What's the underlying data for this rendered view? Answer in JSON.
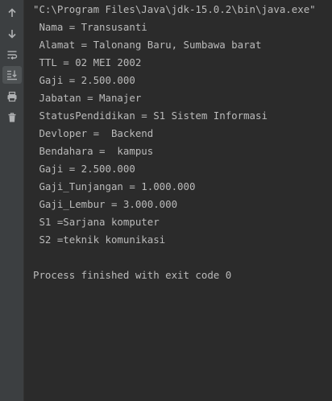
{
  "toolbar": {
    "buttons": [
      {
        "icon": "arrow-up-icon",
        "action": "up-stack-trace"
      },
      {
        "icon": "arrow-down-icon",
        "action": "down-stack-trace"
      },
      {
        "icon": "soft-wrap-icon",
        "action": "soft-wrap"
      },
      {
        "icon": "scroll-to-end-icon",
        "action": "scroll-to-end",
        "active": true
      },
      {
        "icon": "print-icon",
        "action": "print"
      },
      {
        "icon": "trash-icon",
        "action": "clear-all"
      }
    ]
  },
  "console": {
    "lines": [
      "\"C:\\Program Files\\Java\\jdk-15.0.2\\bin\\java.exe\"",
      " Nama = Transusanti",
      " Alamat = Talonang Baru, Sumbawa barat",
      " TTL = 02 MEI 2002",
      " Gaji = 2.500.000",
      " Jabatan = Manajer",
      " StatusPendidikan = S1 Sistem Informasi",
      " Devloper =  Backend",
      " Bendahara =  kampus",
      " Gaji = 2.500.000",
      " Gaji_Tunjangan = 1.000.000",
      " Gaji_Lembur = 3.000.000",
      " S1 =Sarjana komputer",
      " S2 =teknik komunikasi",
      "",
      "Process finished with exit code 0"
    ]
  },
  "colors": {
    "background": "#2b2b2b",
    "toolbar": "#3c3f41",
    "text": "#bbbbbb",
    "icon": "#afb1b3"
  }
}
